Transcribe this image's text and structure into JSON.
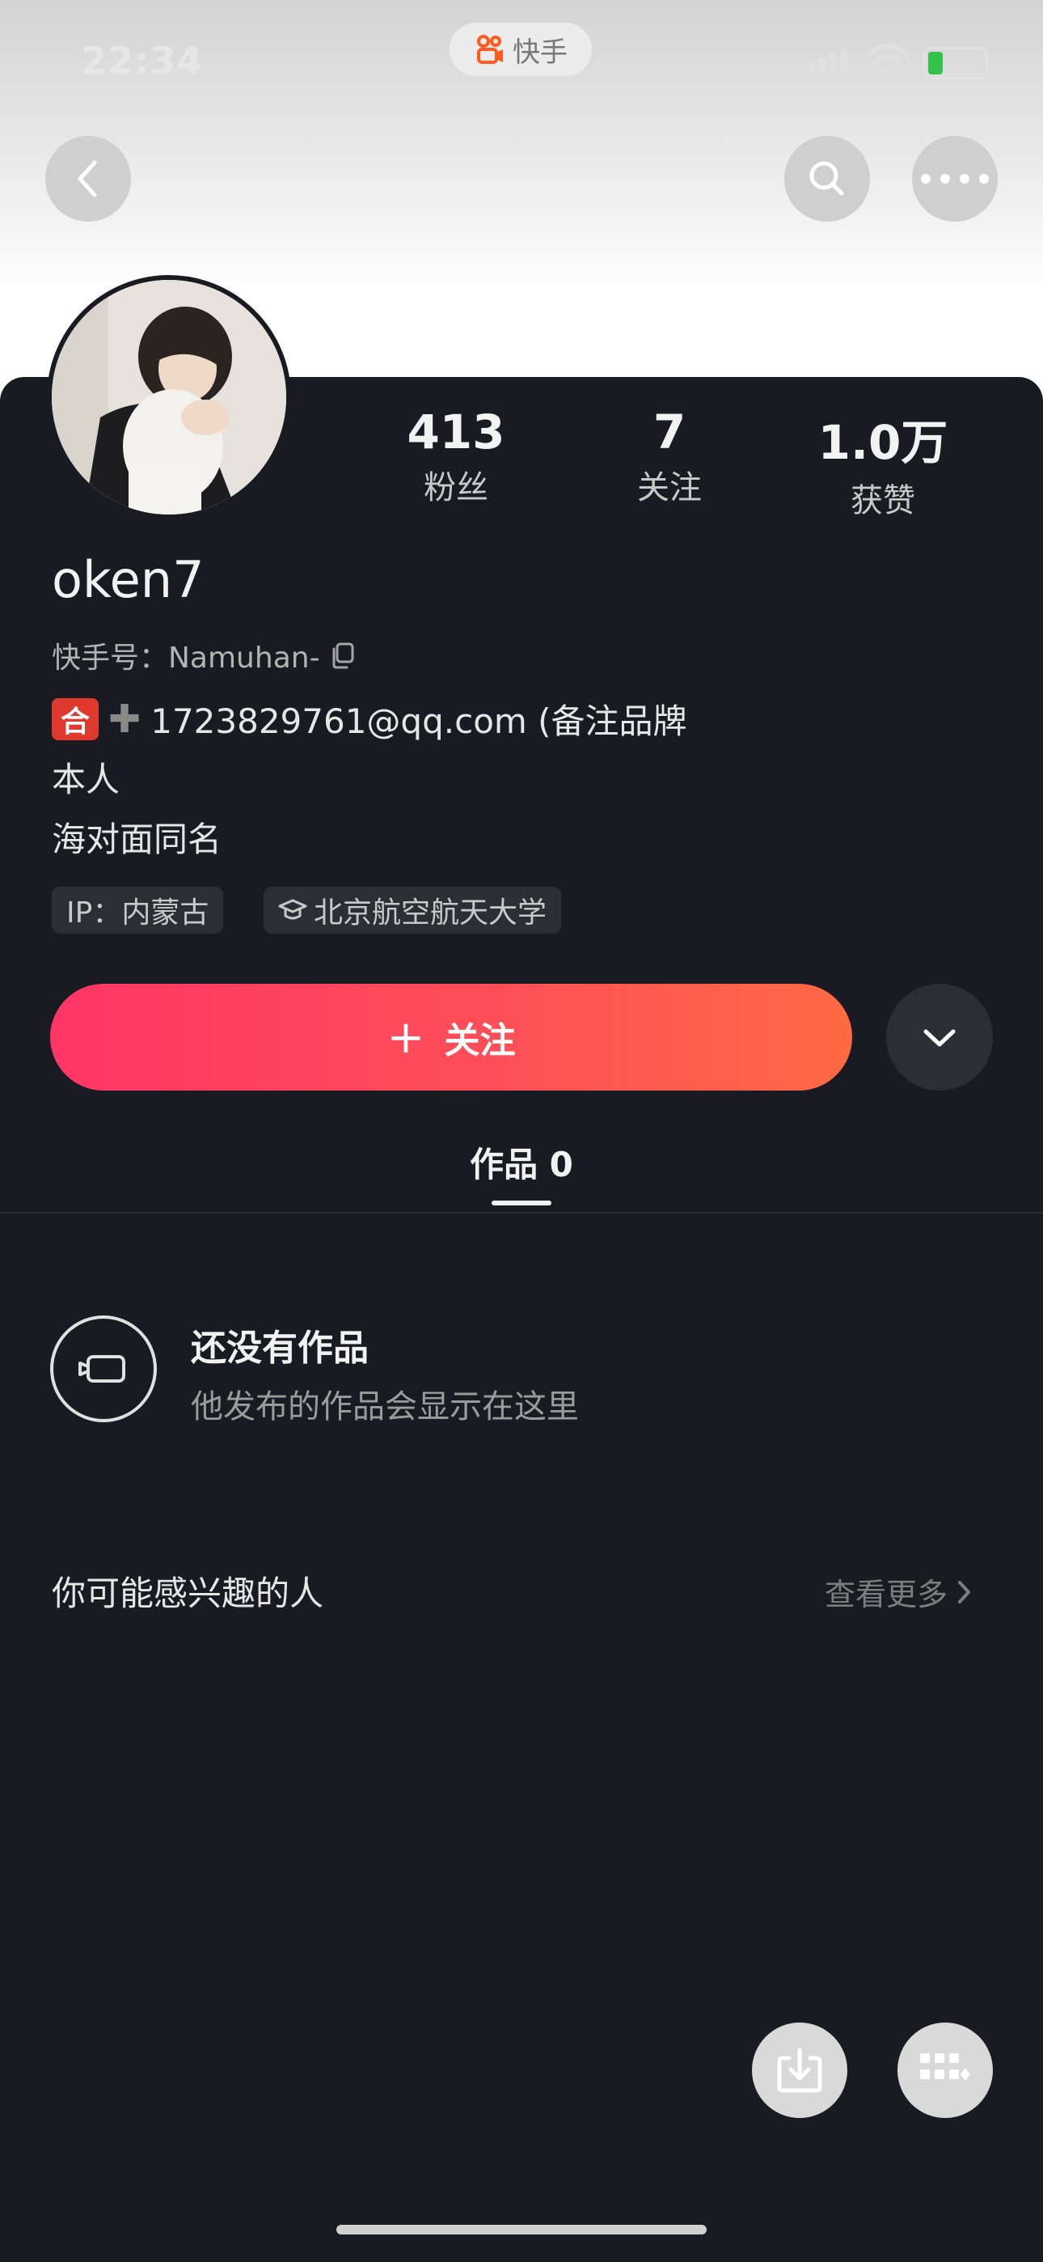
{
  "status_bar": {
    "time": "22:34",
    "app_name": "快手",
    "battery": "26"
  },
  "nav": {
    "back_icon": "chevron-left-icon",
    "search_icon": "search-icon",
    "more_icon": "more-dots-icon"
  },
  "profile": {
    "stats": [
      {
        "num": "413",
        "label": "粉丝"
      },
      {
        "num": "7",
        "label": "关注"
      },
      {
        "num": "1.0万",
        "label": "获赞"
      }
    ],
    "username": "oken7",
    "kuaishou_id": "快手号：Namuhan-",
    "bio_emoji": "合",
    "bio_line1_text": "1723829761@qq.com (备注品牌",
    "bio_line2": "本人",
    "bio_line3": "海对面同名",
    "tags": [
      {
        "text": "IP：内蒙古"
      },
      {
        "text": "北京航空航天大学"
      }
    ]
  },
  "actions": {
    "follow_plus": "+",
    "follow_label": "关注"
  },
  "tabs": {
    "works_label": "作品 0"
  },
  "empty_state": {
    "title": "还没有作品",
    "subtitle": "他发布的作品会显示在这里"
  },
  "suggestions": {
    "title": "你可能感兴趣的人",
    "see_more": "查看更多"
  },
  "colors": {
    "follow_gradient_start": "#fe3666",
    "follow_gradient_end": "#fe6a44",
    "panel_bg": "#1a1b22"
  }
}
